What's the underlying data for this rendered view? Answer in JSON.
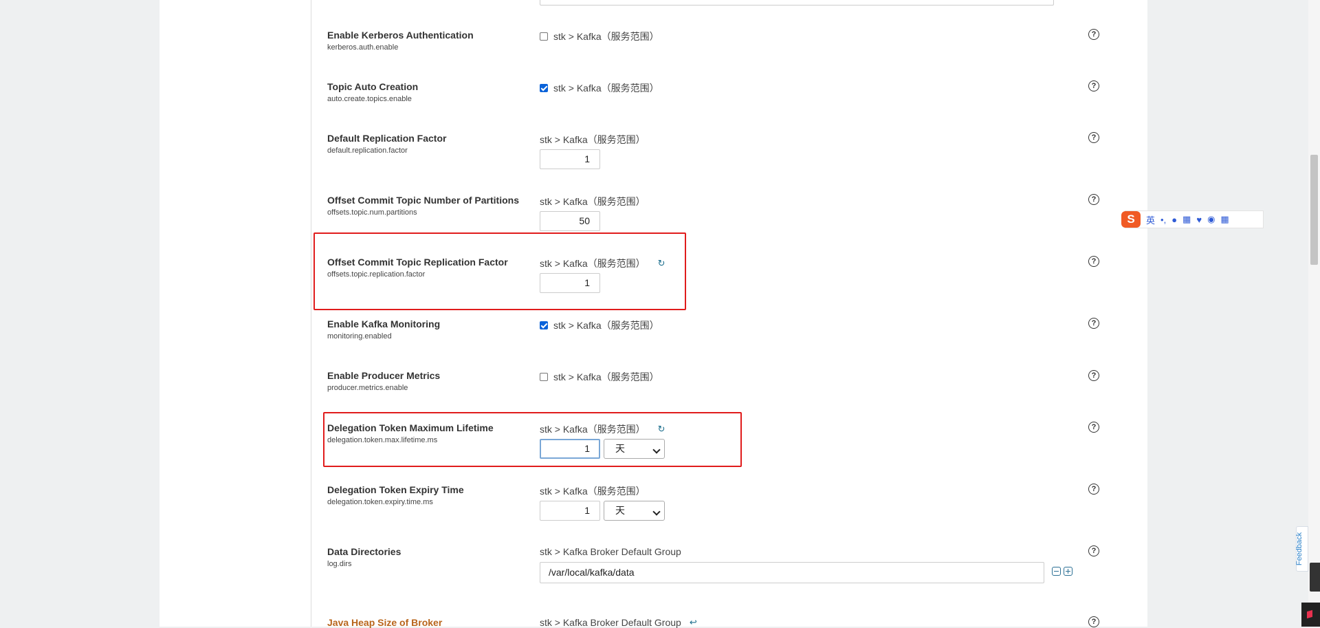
{
  "properties": [
    {
      "label": "Enable Kerberos Authentication",
      "key": "kerberos.auth.enable",
      "scope": "stk > Kafka（服务范围）",
      "control": "checkbox",
      "checked": false
    },
    {
      "label": "Topic Auto Creation",
      "key": "auto.create.topics.enable",
      "scope": "stk > Kafka（服务范围）",
      "control": "checkbox",
      "checked": true
    },
    {
      "label": "Default Replication Factor",
      "key": "default.replication.factor",
      "scope": "stk > Kafka（服务范围）",
      "control": "number",
      "value": "1"
    },
    {
      "label": "Offset Commit Topic Number of Partitions",
      "key": "offsets.topic.num.partitions",
      "scope": "stk > Kafka（服务范围）",
      "control": "number",
      "value": "50"
    },
    {
      "label": "Offset Commit Topic Replication Factor",
      "key": "offsets.topic.replication.factor",
      "scope": "stk > Kafka（服务范围）",
      "control": "number",
      "value": "1",
      "modified": true
    },
    {
      "label": "Enable Kafka Monitoring",
      "key": "monitoring.enabled",
      "scope": "stk > Kafka（服务范围）",
      "control": "checkbox",
      "checked": true
    },
    {
      "label": "Enable Producer Metrics",
      "key": "producer.metrics.enable",
      "scope": "stk > Kafka（服务范围）",
      "control": "checkbox",
      "checked": false
    },
    {
      "label": "Delegation Token Maximum Lifetime",
      "key": "delegation.token.max.lifetime.ms",
      "scope": "stk > Kafka（服务范围）",
      "control": "duration",
      "value": "1",
      "unit": "天",
      "modified": true
    },
    {
      "label": "Delegation Token Expiry Time",
      "key": "delegation.token.expiry.time.ms",
      "scope": "stk > Kafka（服务范围）",
      "control": "duration",
      "value": "1",
      "unit": "天"
    },
    {
      "label": "Data Directories",
      "key": "log.dirs",
      "scope": "stk > Kafka Broker Default Group",
      "control": "list",
      "value": "/var/local/kafka/data"
    },
    {
      "label": "Java Heap Size of Broker",
      "key": "",
      "scope": "stk > Kafka Broker Default Group",
      "control": "none",
      "warning": true
    }
  ],
  "ime": {
    "lang": "英",
    "punct": "•,"
  },
  "feedback": {
    "label": "Feedback"
  },
  "icons": {
    "help": "?",
    "undo": "↻",
    "revert": "↩"
  },
  "colors": {
    "highlight": "#e01b1b",
    "accent": "#0b63d9",
    "warning_label": "#b8651b"
  }
}
